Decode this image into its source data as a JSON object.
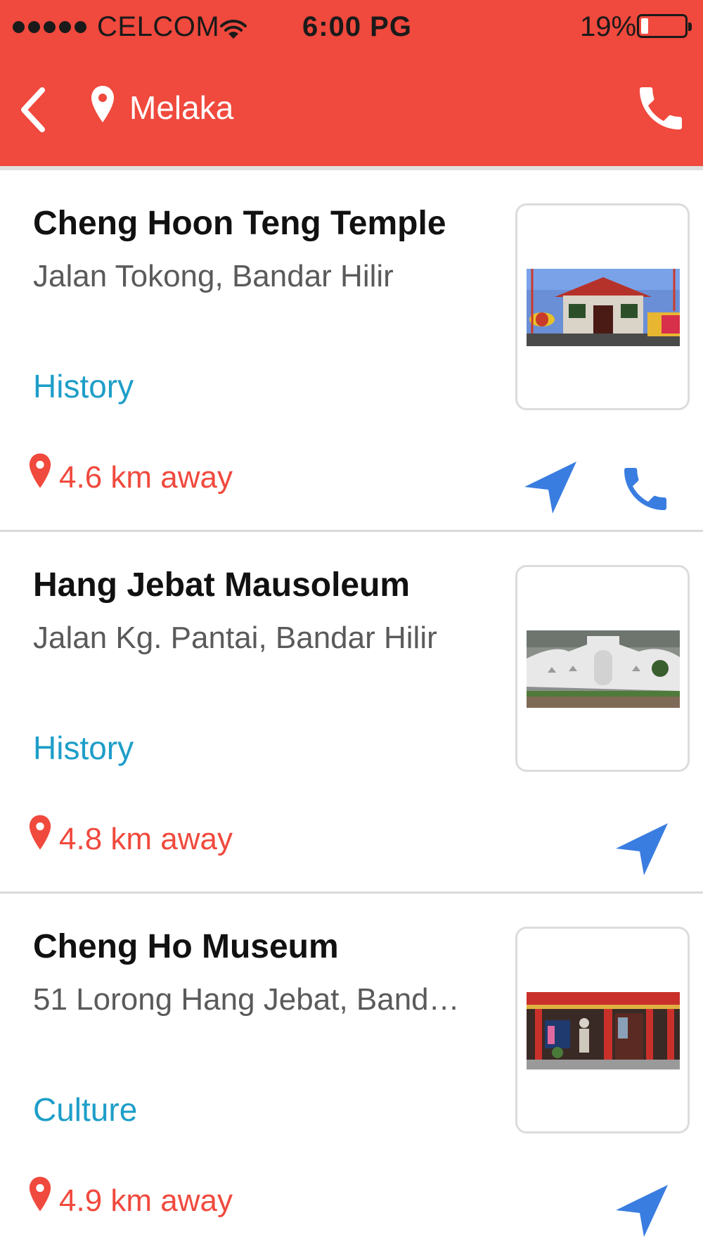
{
  "status_bar": {
    "carrier": "CELCOM",
    "time": "6:00 PG",
    "battery": "19%"
  },
  "header": {
    "location": "Melaka"
  },
  "colors": {
    "header_bg": "#f0493d",
    "category": "#1e9ec8",
    "distance": "#f0493d",
    "action_blue": "#3a7de0"
  },
  "places": [
    {
      "name": "Cheng Hoon Teng Temple",
      "address": "Jalan Tokong, Bandar Hilir",
      "category": "History",
      "distance": "4.6 km away",
      "has_phone": true
    },
    {
      "name": "Hang Jebat Mausoleum",
      "address": "Jalan Kg. Pantai, Bandar Hilir",
      "category": "History",
      "distance": "4.8 km away",
      "has_phone": false
    },
    {
      "name": "Cheng Ho Museum",
      "address": "51 Lorong Hang Jebat, Bandar ...",
      "category": "Culture",
      "distance": "4.9 km away",
      "has_phone": false
    }
  ]
}
